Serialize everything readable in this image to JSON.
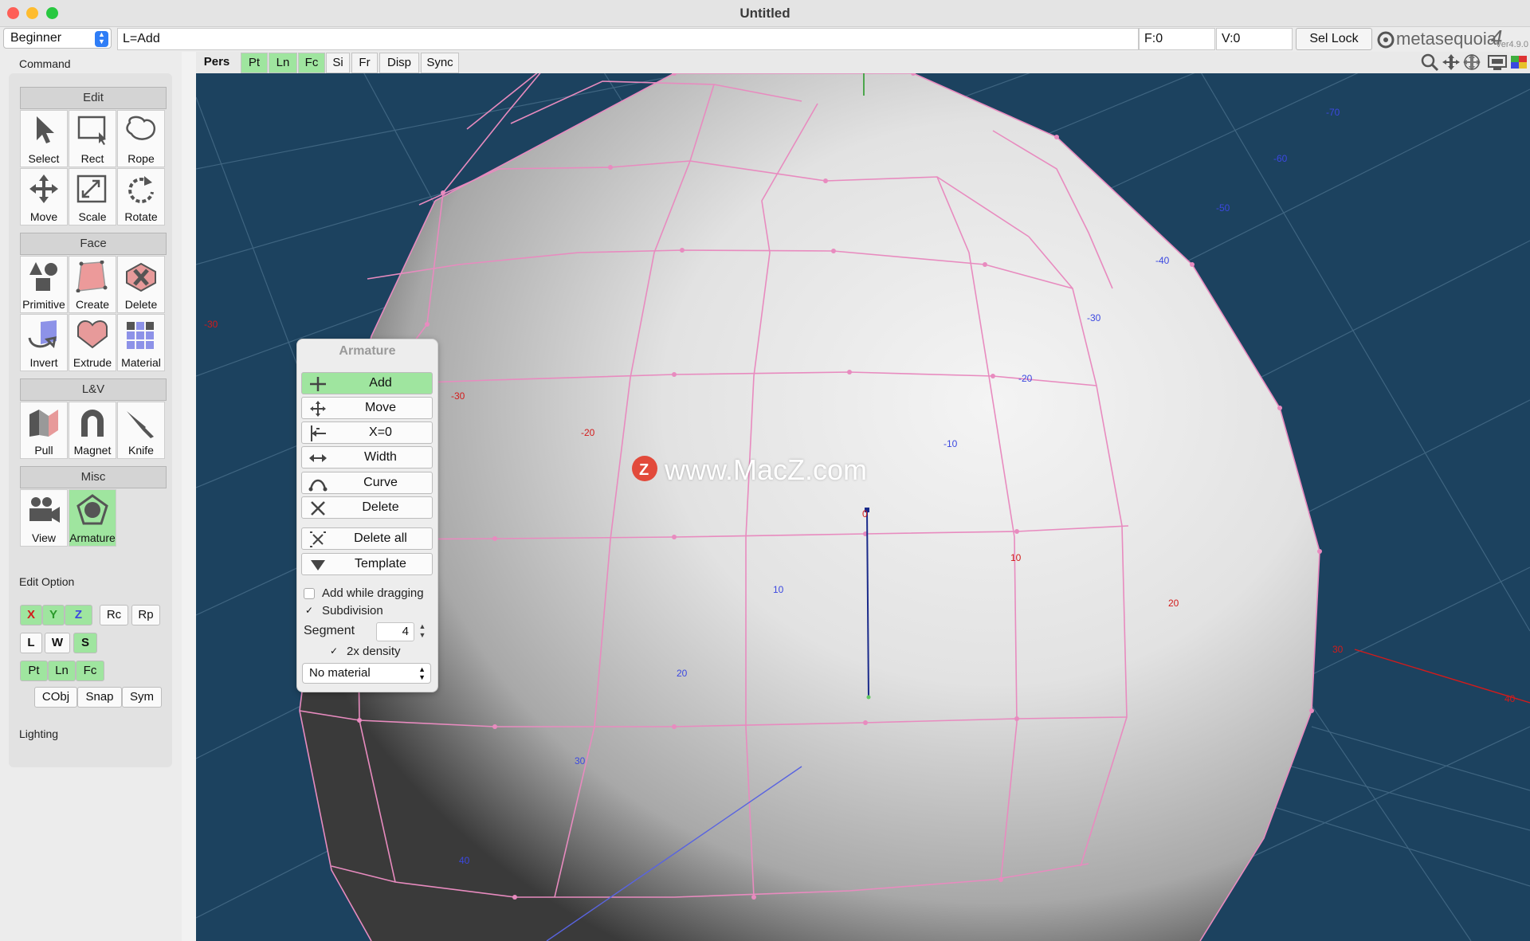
{
  "window": {
    "title": "Untitled"
  },
  "topbar": {
    "mode_select": "Beginner",
    "command_field": "L=Add",
    "faces": "F:0",
    "vertices": "V:0",
    "sel_lock_label": "Sel Lock",
    "logo_text": "metasequoia",
    "logo_version_num": "4",
    "version": "Ver4.9.0"
  },
  "viewport_toolbar": {
    "buttons": [
      "Pers",
      "Pt",
      "Ln",
      "Fc",
      "Si",
      "Fr",
      "Disp",
      "Sync"
    ],
    "active": [
      "Pt",
      "Ln",
      "Fc"
    ]
  },
  "left_panel": {
    "command_label": "Command",
    "groups": [
      {
        "name": "Edit",
        "tools": [
          "Select",
          "Rect",
          "Rope",
          "Move",
          "Scale",
          "Rotate"
        ]
      },
      {
        "name": "Face",
        "tools": [
          "Primitive",
          "Create",
          "Delete",
          "Invert",
          "Extrude",
          "Material"
        ]
      },
      {
        "name": "L&V",
        "tools": [
          "Pull",
          "Magnet",
          "Knife"
        ]
      },
      {
        "name": "Misc",
        "tools": [
          "View",
          "Armature"
        ]
      }
    ],
    "active_tool": "Armature",
    "edit_option_label": "Edit Option",
    "edit_option": {
      "axes": [
        "X",
        "Y",
        "Z"
      ],
      "rc": "Rc",
      "rp": "Rp",
      "lws": [
        "L",
        "W",
        "S"
      ],
      "elements": [
        "Pt",
        "Ln",
        "Fc"
      ],
      "cobj": "CObj",
      "snap": "Snap",
      "sym": "Sym"
    },
    "lighting_label": "Lighting"
  },
  "armature_panel": {
    "title": "Armature",
    "buttons": [
      "Add",
      "Move",
      "X=0",
      "Width",
      "Curve",
      "Delete",
      "Delete all",
      "Template"
    ],
    "active": "Add",
    "add_while_dragging": {
      "label": "Add while dragging",
      "checked": false
    },
    "subdivision": {
      "label": "Subdivision",
      "checked": true
    },
    "segment_label": "Segment",
    "segment_value": "4",
    "density": {
      "label": "2x density",
      "checked": true
    },
    "material_select": "No material"
  },
  "viewport_labels": {
    "watermark": "www.MacZ.com",
    "red": [
      "-30",
      "-30",
      "-20",
      "10",
      "20",
      "30",
      "40",
      "0"
    ],
    "blue": [
      "-70",
      "-60",
      "-50",
      "-40",
      "-30",
      "-20",
      "-10",
      "10",
      "20",
      "30",
      "40"
    ]
  },
  "colors": {
    "accent_green": "#9fe59f",
    "viewport_bg": "#1c425f",
    "wire_pink": "#e88bbf"
  }
}
